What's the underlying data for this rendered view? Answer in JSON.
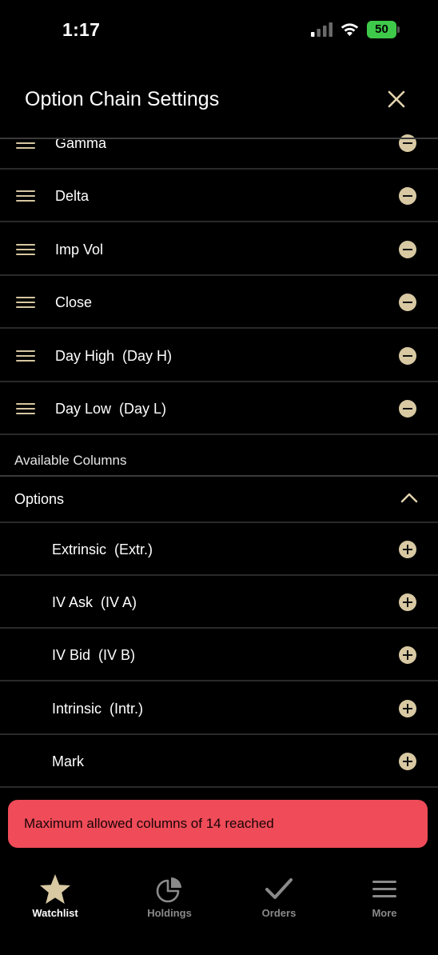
{
  "status_bar": {
    "time": "1:17",
    "battery": "50"
  },
  "header": {
    "title": "Option Chain Settings"
  },
  "selected_columns": [
    {
      "label": "Gamma"
    },
    {
      "label": "Delta"
    },
    {
      "label": "Imp Vol"
    },
    {
      "label": "Close"
    },
    {
      "label": "Day High  (Day H)"
    },
    {
      "label": "Day Low  (Day L)"
    }
  ],
  "available": {
    "section_title": "Available Columns",
    "group_label": "Options",
    "items": [
      {
        "label": "Extrinsic  (Extr.)"
      },
      {
        "label": "IV Ask  (IV A)"
      },
      {
        "label": "IV Bid  (IV B)"
      },
      {
        "label": "Intrinsic  (Intr.)"
      },
      {
        "label": "Mark"
      }
    ]
  },
  "toast": {
    "message": "Maximum allowed columns of 14 reached"
  },
  "tabbar": {
    "tabs": [
      {
        "label": "Watchlist",
        "icon": "star-icon",
        "active": true
      },
      {
        "label": "Holdings",
        "icon": "pie-chart-icon",
        "active": false
      },
      {
        "label": "Orders",
        "icon": "checkmark-icon",
        "active": false
      },
      {
        "label": "More",
        "icon": "hamburger-icon",
        "active": false
      }
    ]
  },
  "colors": {
    "accent": "#d8c9a3",
    "toast": "#ef4b58",
    "battery": "#3fc94a"
  }
}
